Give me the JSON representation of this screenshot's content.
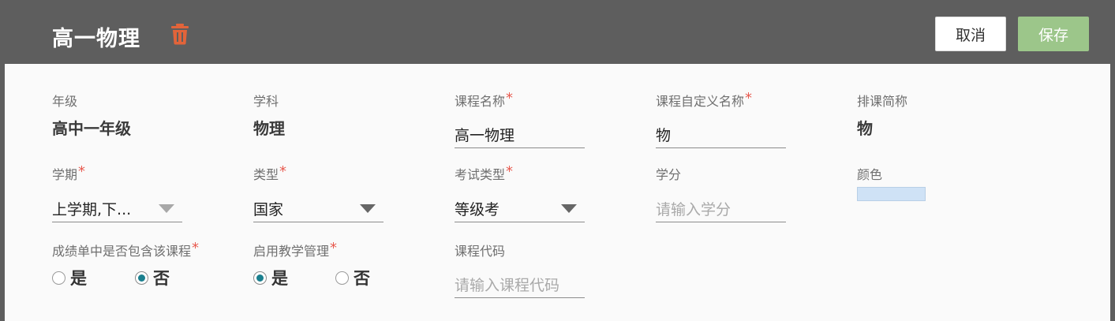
{
  "header": {
    "title": "高一物理",
    "cancel_label": "取消",
    "save_label": "保存",
    "accent_trash": "#e2643a",
    "save_color": "#9cc68a"
  },
  "form": {
    "grade": {
      "label": "年级",
      "value": "高中一年级"
    },
    "subject": {
      "label": "学科",
      "value": "物理"
    },
    "course_name": {
      "label": "课程名称",
      "required": "*",
      "value": "高一物理"
    },
    "custom_name": {
      "label": "课程自定义名称",
      "required": "*",
      "value": "物"
    },
    "short_name": {
      "label": "排课简称",
      "value": "物"
    },
    "term": {
      "label": "学期",
      "required": "*",
      "value": "上学期,下..."
    },
    "type": {
      "label": "类型",
      "required": "*",
      "value": "国家"
    },
    "exam_type": {
      "label": "考试类型",
      "required": "*",
      "value": "等级考"
    },
    "credit": {
      "label": "学分",
      "placeholder": "请输入学分"
    },
    "color": {
      "label": "颜色",
      "value": "#cfe2f6"
    },
    "in_transcript": {
      "label": "成绩单中是否包含该课程",
      "required": "*",
      "options": [
        "是",
        "否"
      ],
      "selected": "否"
    },
    "teaching_mgmt": {
      "label": "启用教学管理",
      "required": "*",
      "options": [
        "是",
        "否"
      ],
      "selected": "是"
    },
    "course_code": {
      "label": "课程代码",
      "placeholder": "请输入课程代码"
    }
  }
}
